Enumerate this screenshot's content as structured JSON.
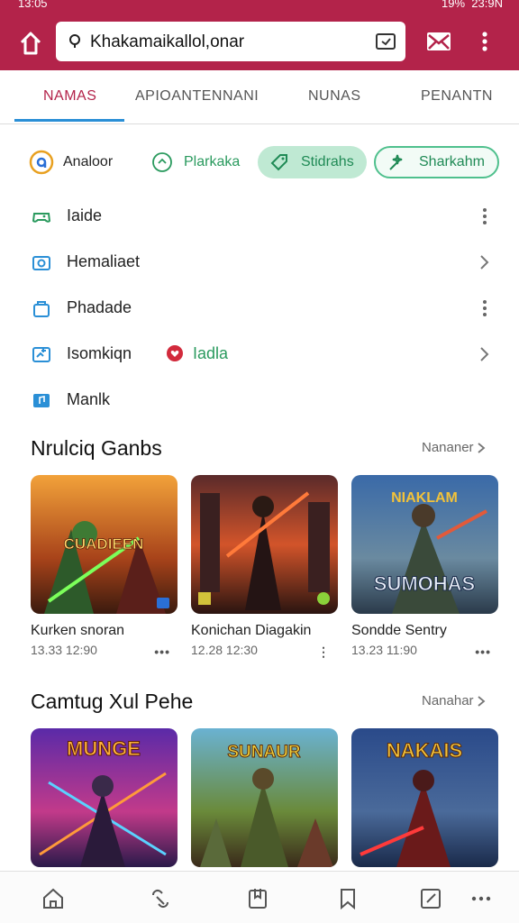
{
  "status_bar": {
    "time_left": "13:05",
    "battery": "19%",
    "time_right": "23:9N"
  },
  "browser": {
    "url": "Khakamaikallol,onar"
  },
  "tabs": [
    "NAMAS",
    "APIOANTENNANI",
    "NUNAS",
    "PENANTN"
  ],
  "chips": [
    "Analoor",
    "Plarkaka",
    "Stidrahs",
    "Sharkahm"
  ],
  "menu": [
    {
      "label": "Iaide",
      "trailing": "kebab"
    },
    {
      "label": "Hemaliaet",
      "trailing": "chevron"
    },
    {
      "label": "Phadade",
      "trailing": "kebab"
    },
    {
      "label": "Isomkiqn",
      "tag": "Iadla",
      "trailing": "chevron"
    },
    {
      "label": "Manlk",
      "trailing": ""
    }
  ],
  "sections": [
    {
      "title": "Nrulciq Ganbs",
      "see_more": "Nananer",
      "cards": [
        {
          "title": "Kurken snoran",
          "meta": "13.33 12:90",
          "art": "CUADIEEN"
        },
        {
          "title": "Konichan Diagakin",
          "meta": "12.28 12:30",
          "art": ""
        },
        {
          "title": "Sondde Sentry",
          "meta": "13.23 11:90",
          "art": "SUMOHAS"
        }
      ]
    },
    {
      "title": "Camtug Xul Pehe",
      "see_more": "Nanahar",
      "cards": [
        {
          "title": "",
          "meta": "",
          "art": "MUNGE"
        },
        {
          "title": "",
          "meta": "",
          "art": "SUNAUR"
        },
        {
          "title": "",
          "meta": "",
          "art": "NAKAIS"
        }
      ]
    }
  ],
  "colors": {
    "brand": "#b3234a",
    "accent": "#2a8fd6",
    "green": "#2a9a5e"
  },
  "icons": {
    "bottom_nav": [
      "home-icon",
      "link-icon",
      "bookmark-folder-icon",
      "bookmark-icon",
      "edit-icon",
      "more-icon"
    ]
  }
}
